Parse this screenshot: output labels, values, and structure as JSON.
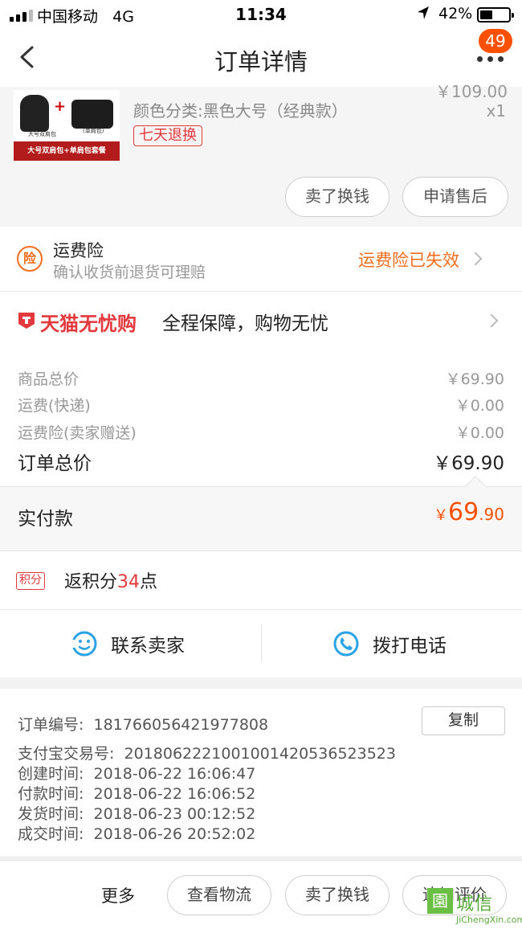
{
  "status_bar": {
    "carrier": "中国移动",
    "network": "4G",
    "time": "11:34",
    "battery": "42%",
    "location_icon": "location-arrow-icon"
  },
  "nav": {
    "title": "订单详情",
    "badge": "49",
    "back_icon": "chevron-left-icon",
    "more_icon": "more-dots-icon"
  },
  "product": {
    "image_banner": "大号双肩包+单肩包套餐",
    "image_caption_left": "大号双肩包",
    "image_caption_right": "(单肩包)",
    "sku": "颜色分类:黑色大号（经典款）",
    "price_cut": "￥109.00",
    "qty": "x1",
    "tag": "七天退换",
    "btn_sell": "卖了换钱",
    "btn_aftersale": "申请售后"
  },
  "insurance": {
    "icon_text": "险",
    "title": "运费险",
    "subtitle": "确认收货前退货可理赔",
    "status": "运费险已失效"
  },
  "tmall": {
    "brand": "天猫无忧购",
    "slogan": "全程保障，购物无忧"
  },
  "prices": {
    "goods_label": "商品总价",
    "goods_value": "￥69.90",
    "shipping_label": "运费(快递)",
    "shipping_value": "￥0.00",
    "insurance_label": "运费险(卖家赠送)",
    "insurance_value": "￥0.00",
    "total_label": "订单总价",
    "total_value": "￥69.90"
  },
  "payment": {
    "label": "实付款",
    "currency": "￥",
    "integer": "69",
    "decimal": ".90"
  },
  "points": {
    "tag": "积分",
    "prefix": "返积分",
    "number": "34",
    "suffix": "点"
  },
  "contact": {
    "seller": "联系卖家",
    "phone": "拨打电话"
  },
  "order_info": {
    "order_no_label": "订单编号:",
    "order_no": "181766056421977808",
    "copy": "复制",
    "alipay_label": "支付宝交易号:",
    "alipay_no": "2018062221001001420536523523",
    "created_label": "创建时间:",
    "created": "2018-06-22 16:06:47",
    "paid_label": "付款时间:",
    "paid": "2018-06-22 16:06:52",
    "shipped_label": "发货时间:",
    "shipped": "2018-06-23 00:12:52",
    "done_label": "成交时间:",
    "done": "2018-06-26 20:52:02"
  },
  "bottom": {
    "more": "更多",
    "logistics": "查看物流",
    "sell": "卖了换钱",
    "review": "追加评价"
  },
  "watermark": {
    "box": "園",
    "cn": "城信",
    "en": "JiChengXin.com"
  },
  "colors": {
    "accent": "#ff5000",
    "tmall_red": "#e4393c",
    "insurance_orange": "#f36d1e",
    "contact_blue": "#2aa3e6"
  }
}
